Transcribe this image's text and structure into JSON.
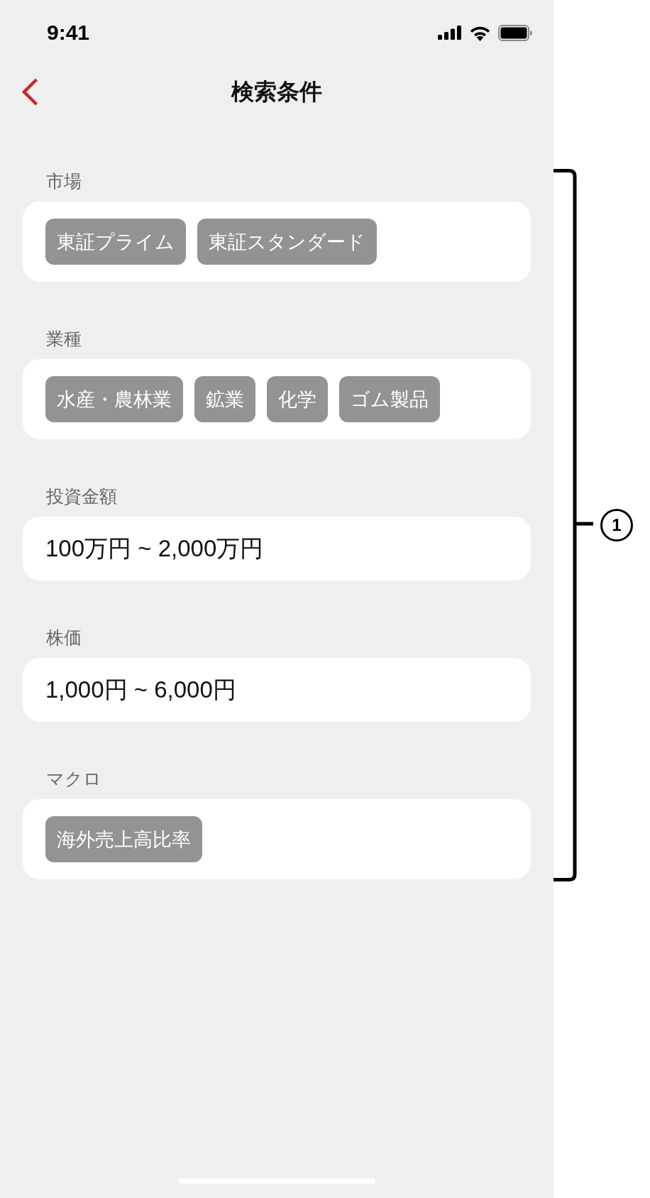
{
  "status_bar": {
    "time": "9:41"
  },
  "header": {
    "title": "検索条件"
  },
  "sections": [
    {
      "label": "市場",
      "kind": "chips",
      "chips": [
        "東証プライム",
        "東証スタンダード"
      ]
    },
    {
      "label": "業種",
      "kind": "chips",
      "chips": [
        "水産・農林業",
        "鉱業",
        "化学",
        "ゴム製品"
      ]
    },
    {
      "label": "投資金額",
      "kind": "range",
      "value": "100万円 ~ 2,000万円"
    },
    {
      "label": "株価",
      "kind": "range",
      "value": "1,000円 ~ 6,000円"
    },
    {
      "label": "マクロ",
      "kind": "chips",
      "chips": [
        "海外売上高比率"
      ]
    }
  ],
  "annotation": {
    "callout": "1"
  }
}
